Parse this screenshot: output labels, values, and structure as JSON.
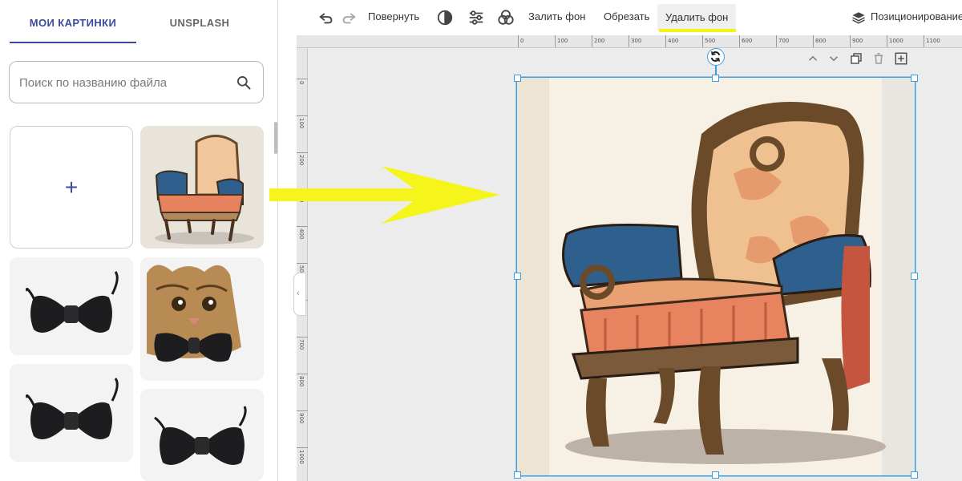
{
  "sidebar": {
    "tabs": [
      {
        "label": "МОИ КАРТИНКИ",
        "active": true
      },
      {
        "label": "UNSPLASH",
        "active": false
      }
    ],
    "search": {
      "placeholder": "Поиск по названию файла",
      "value": ""
    },
    "add_tile": {
      "symbol": "+"
    },
    "thumbnails": [
      {
        "name": "chair"
      },
      {
        "name": "bow-tie"
      },
      {
        "name": "cat-with-bow-tie"
      },
      {
        "name": "bow-tie"
      },
      {
        "name": "bow-tie"
      }
    ]
  },
  "toolbar": {
    "rotate_label": "Повернуть",
    "fill_bg_label": "Залить фон",
    "crop_label": "Обрезать",
    "remove_bg_label": "Удалить фон",
    "positioning_label": "Позиционирование",
    "icons": [
      "undo-icon",
      "redo-icon",
      "contrast-icon",
      "adjust-sliders-icon",
      "filters-icon",
      "layers-icon"
    ]
  },
  "ruler": {
    "top_ticks": [
      "0",
      "100",
      "200",
      "300",
      "400",
      "500",
      "600",
      "700",
      "800",
      "900",
      "1000",
      "1100"
    ],
    "left_ticks": [
      "0",
      "100",
      "200",
      "300",
      "400",
      "500",
      "600",
      "700",
      "800",
      "900",
      "1000"
    ]
  },
  "colors": {
    "accent": "#3b4a9c",
    "selection": "#3a9ee0",
    "highlight": "#f3f31a"
  }
}
